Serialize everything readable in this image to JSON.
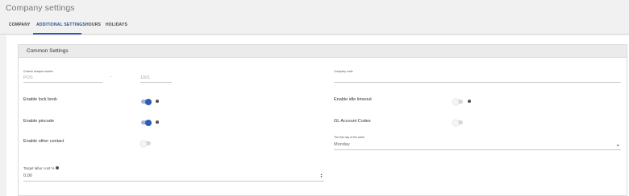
{
  "page": {
    "title": "Company settings"
  },
  "tabs": [
    {
      "label": "COMPANY"
    },
    {
      "label": "ADDITIONAL SETTINGS"
    },
    {
      "label": "HOURS"
    },
    {
      "label": "HOLIDAYS"
    }
  ],
  "card": {
    "title": "Common Settings",
    "custom_analyst": {
      "label": "Custom analyst number",
      "prefix_value": "POS",
      "number_value": "1001"
    },
    "company_code": {
      "label": "Company code",
      "value": ""
    },
    "enable_lock_book": {
      "label": "Enable lock book",
      "state": "on"
    },
    "enable_idle_timeout": {
      "label": "Enable idle timeout",
      "state": "off"
    },
    "enable_pincode": {
      "label": "Enable pincode",
      "state": "on"
    },
    "gl_account_codes": {
      "label": "GL Account Codes",
      "state": "off"
    },
    "enable_other_contact": {
      "label": "Enable other contact",
      "state": "off"
    },
    "first_day_of_week": {
      "label": "The first day of the week",
      "value": "Monday"
    },
    "target_labor_cost": {
      "label": "Target labor cost %",
      "value": "0.00"
    }
  },
  "colors": {
    "accent": "#2f5bb6",
    "accent_track": "#9db3e0",
    "header_bg": "#ebebeb"
  },
  "icons": [
    "info-icon",
    "info-icon",
    "info-icon",
    "chevron-down-icon",
    "stepper-arrows-icon"
  ]
}
